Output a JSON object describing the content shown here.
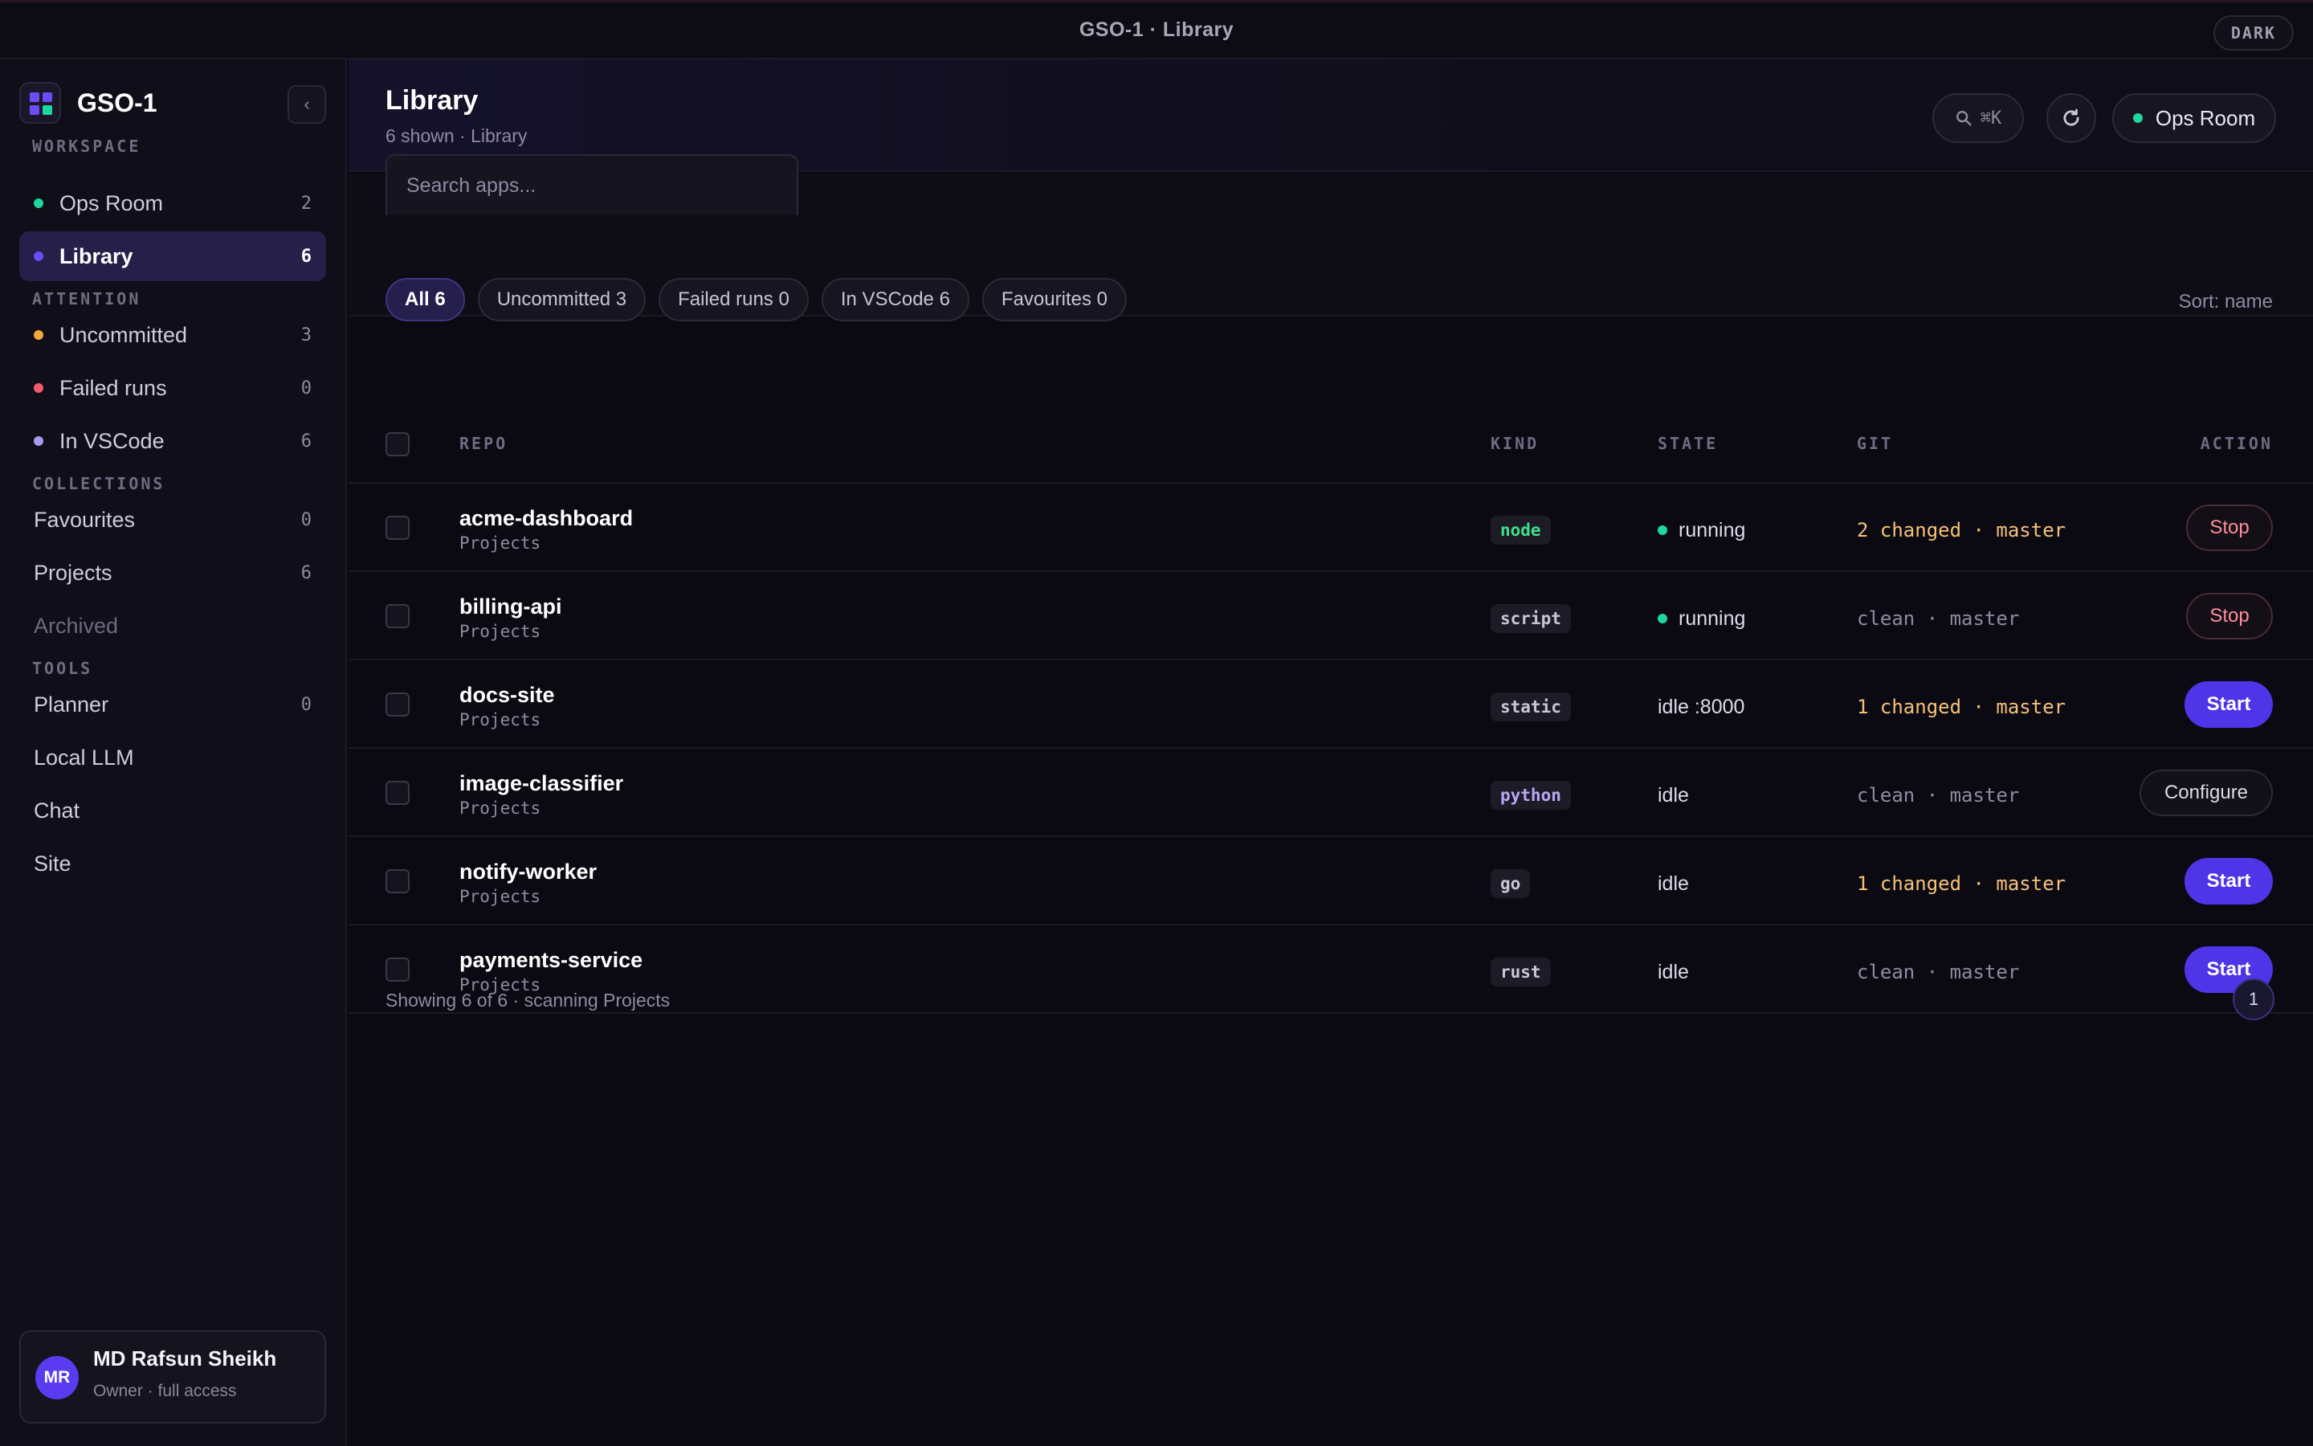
{
  "window": {
    "title": "GSO-1 · Library",
    "theme_label": "DARK"
  },
  "brand": {
    "name": "GSO-1",
    "collapse_glyph": "‹"
  },
  "sidebar": {
    "sections": {
      "workspace": "WORKSPACE",
      "attention": "ATTENTION",
      "collections": "COLLECTIONS",
      "tools": "TOOLS"
    },
    "workspace": [
      {
        "label": "Ops Room",
        "count": "2",
        "dot": "#1ed6a0"
      },
      {
        "label": "Library",
        "count": "6",
        "dot": "#6b4cf6"
      }
    ],
    "attention": [
      {
        "label": "Uncommitted",
        "count": "3",
        "dot": "#f2a93b"
      },
      {
        "label": "Failed runs",
        "count": "0",
        "dot": "#f05a6a"
      },
      {
        "label": "In VSCode",
        "count": "6",
        "dot": "#a899f5"
      }
    ],
    "collections": [
      {
        "label": "Favourites",
        "count": "0"
      },
      {
        "label": "Projects",
        "count": "6"
      },
      {
        "label": "Archived",
        "count": ""
      }
    ],
    "tools": [
      {
        "label": "Planner",
        "count": "0"
      },
      {
        "label": "Local LLM",
        "count": ""
      },
      {
        "label": "Chat",
        "count": ""
      },
      {
        "label": "Site",
        "count": ""
      }
    ]
  },
  "user": {
    "initials": "MR",
    "name": "MD Rafsun Sheikh",
    "role": "Owner · full access"
  },
  "header": {
    "title": "Library",
    "subtitle": "6 shown · Library",
    "search_shortcut": "⌘K",
    "ops_label": "Ops Room"
  },
  "search": {
    "placeholder": "Search apps..."
  },
  "filters": [
    "All 6",
    "Uncommitted 3",
    "Failed runs 0",
    "In VSCode 6",
    "Favourites 0"
  ],
  "sort_label": "Sort: name",
  "table": {
    "headers": {
      "repo": "REPO",
      "kind": "KIND",
      "state": "STATE",
      "git": "GIT",
      "action": "ACTION"
    },
    "rows": [
      {
        "name": "acme-dashboard",
        "group": "Projects",
        "kind": "node",
        "kind_color": "#3ee08a",
        "state": "running",
        "running": true,
        "git": "2 changed · master",
        "dirty": true,
        "action": "Stop"
      },
      {
        "name": "billing-api",
        "group": "Projects",
        "kind": "script",
        "kind_color": "#c9c6d6",
        "state": "running",
        "running": true,
        "git": "clean · master",
        "dirty": false,
        "action": "Stop"
      },
      {
        "name": "docs-site",
        "group": "Projects",
        "kind": "static",
        "kind_color": "#c9c6d6",
        "state": "idle :8000",
        "running": false,
        "git": "1 changed · master",
        "dirty": true,
        "action": "Start"
      },
      {
        "name": "image-classifier",
        "group": "Projects",
        "kind": "python",
        "kind_color": "#b9a8f5",
        "state": "idle",
        "running": false,
        "git": "clean · master",
        "dirty": false,
        "action": "Configure"
      },
      {
        "name": "notify-worker",
        "group": "Projects",
        "kind": "go",
        "kind_color": "#c9c6d6",
        "state": "idle",
        "running": false,
        "git": "1 changed · master",
        "dirty": true,
        "action": "Start"
      },
      {
        "name": "payments-service",
        "group": "Projects",
        "kind": "rust",
        "kind_color": "#c9c6d6",
        "state": "idle",
        "running": false,
        "git": "clean · master",
        "dirty": false,
        "action": "Start"
      }
    ]
  },
  "footer": {
    "info": "Showing 6 of 6 · scanning Projects",
    "page": "1"
  },
  "colors": {
    "accent": "#4f35e8",
    "dirty_git": "#f5c27a",
    "clean_git": "#8e8ba2"
  }
}
